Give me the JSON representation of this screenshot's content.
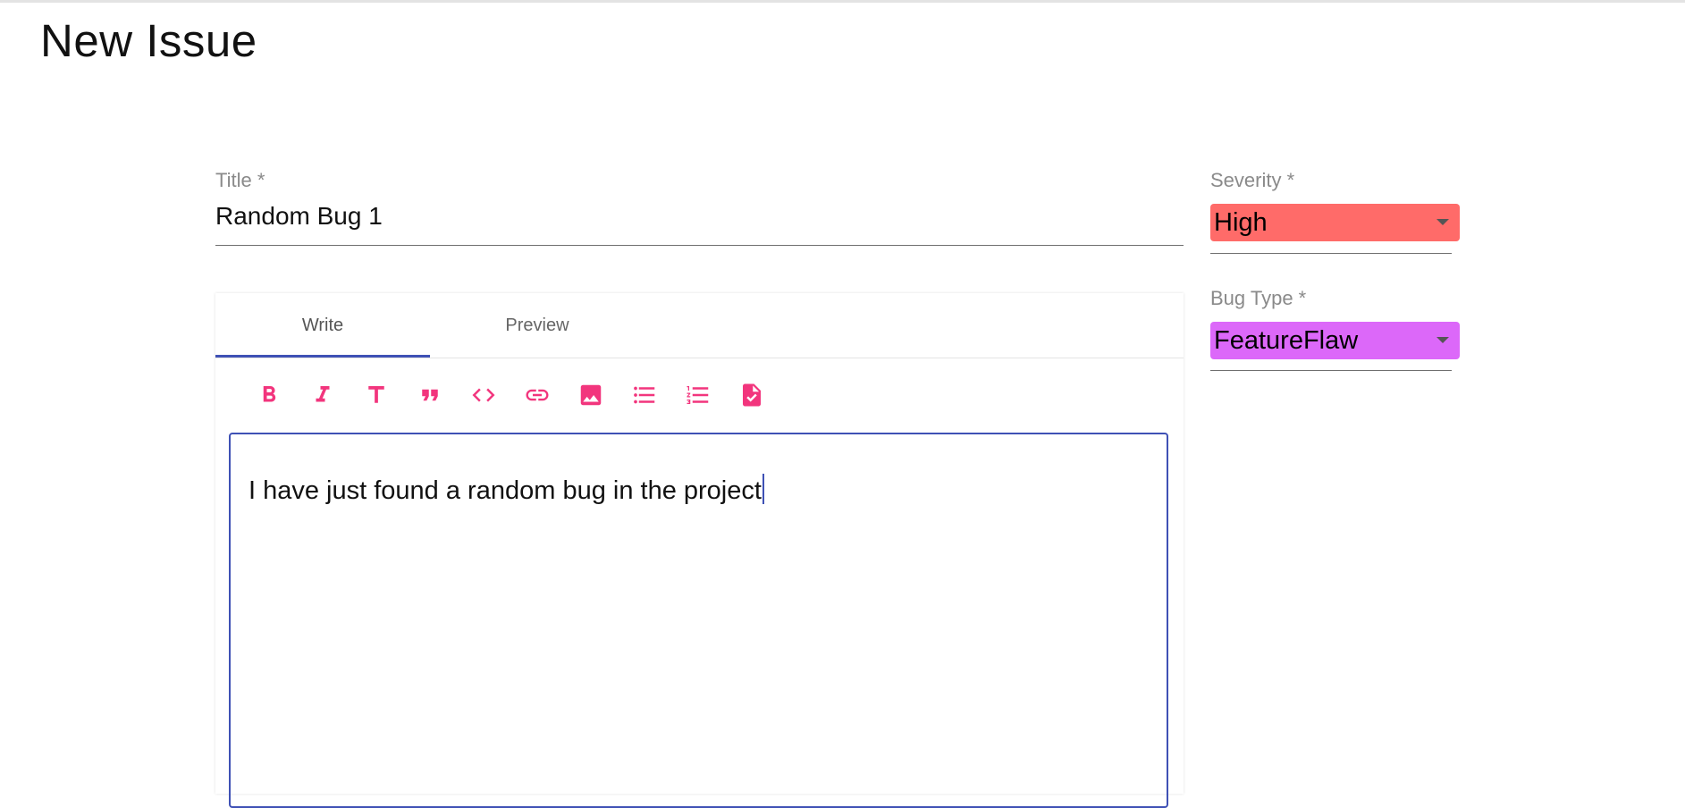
{
  "page": {
    "title": "New Issue"
  },
  "title_field": {
    "label": "Title *",
    "value": "Random Bug 1"
  },
  "editor": {
    "tabs": [
      {
        "label": "Write",
        "active": true
      },
      {
        "label": "Preview",
        "active": false
      }
    ],
    "toolbar": [
      {
        "name": "bold-icon"
      },
      {
        "name": "italic-icon"
      },
      {
        "name": "header-icon"
      },
      {
        "name": "quote-icon"
      },
      {
        "name": "code-icon"
      },
      {
        "name": "link-icon"
      },
      {
        "name": "image-icon"
      },
      {
        "name": "unordered-list-icon"
      },
      {
        "name": "ordered-list-icon"
      },
      {
        "name": "checked-list-icon"
      }
    ],
    "content": "I have just found a random bug in the project"
  },
  "severity": {
    "label": "Severity *",
    "value": "High",
    "color": "#ff6b69"
  },
  "bug_type": {
    "label": "Bug Type *",
    "value": "FeatureFlaw",
    "color": "#dc68f9"
  },
  "colors": {
    "accent": "#3f51b5",
    "toolbar_icon": "#f2357d"
  }
}
